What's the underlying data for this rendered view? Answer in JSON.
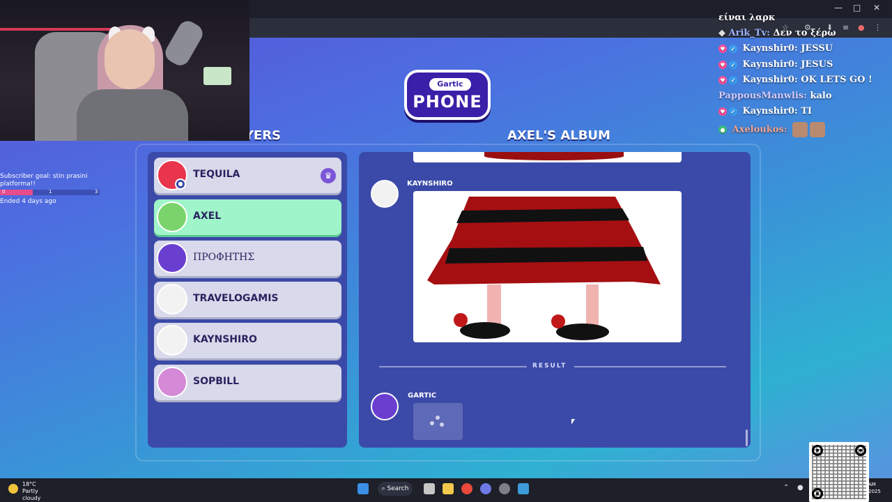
{
  "window": {
    "minimize": "—",
    "maximize": "□",
    "close": "✕"
  },
  "browser": {
    "icons": [
      "star-icon",
      "extensions-icon",
      "download-icon",
      "media-icon",
      "profile-icon",
      "menu-icon"
    ]
  },
  "logo": {
    "top": "Gartic",
    "bottom": "PHONE"
  },
  "players": {
    "title": "PLAYERS",
    "list": [
      {
        "name": "TEQUILA",
        "owner": true
      },
      {
        "name": "AXEL",
        "active": true
      },
      {
        "name": "ΠΡΟΦΗΤΗΣ"
      },
      {
        "name": "TRAVELOGAMIS"
      },
      {
        "name": "KAYNSHIRO"
      },
      {
        "name": "SOPBILL"
      }
    ]
  },
  "album": {
    "title": "AXEL'S ALBUM",
    "entries": [
      {
        "author": "KAYNSHIRO"
      },
      {
        "author": "GARTIC"
      }
    ],
    "result_label": "RESULT"
  },
  "subscriber_goal": {
    "label": "Subscriber goal: stin prasini platforma!!",
    "progress_min": "0",
    "progress_current": "1",
    "progress_max": "3",
    "status": "Ended 4 days ago"
  },
  "chat": [
    {
      "name": "",
      "msg": "είναι λαρκ"
    },
    {
      "name": "Arik_Tv:",
      "msg": "Δεν το ξέρω"
    },
    {
      "name": "Kaynshir0:",
      "msg": "JESSU"
    },
    {
      "name": "Kaynshir0:",
      "msg": "JESUS"
    },
    {
      "name": "Kaynshir0:",
      "msg": "OK LETS GO !"
    },
    {
      "name": "PappousManwlis:",
      "msg": "kalo"
    },
    {
      "name": "Kaynshir0:",
      "msg": "TI"
    },
    {
      "name": "Axeloukos:",
      "msg": ""
    }
  ],
  "taskbar": {
    "weather_temp": "18°C",
    "weather_desc": "Partly cloudy",
    "search": "Search",
    "clock_time": "AM",
    "clock_date": "2025"
  }
}
